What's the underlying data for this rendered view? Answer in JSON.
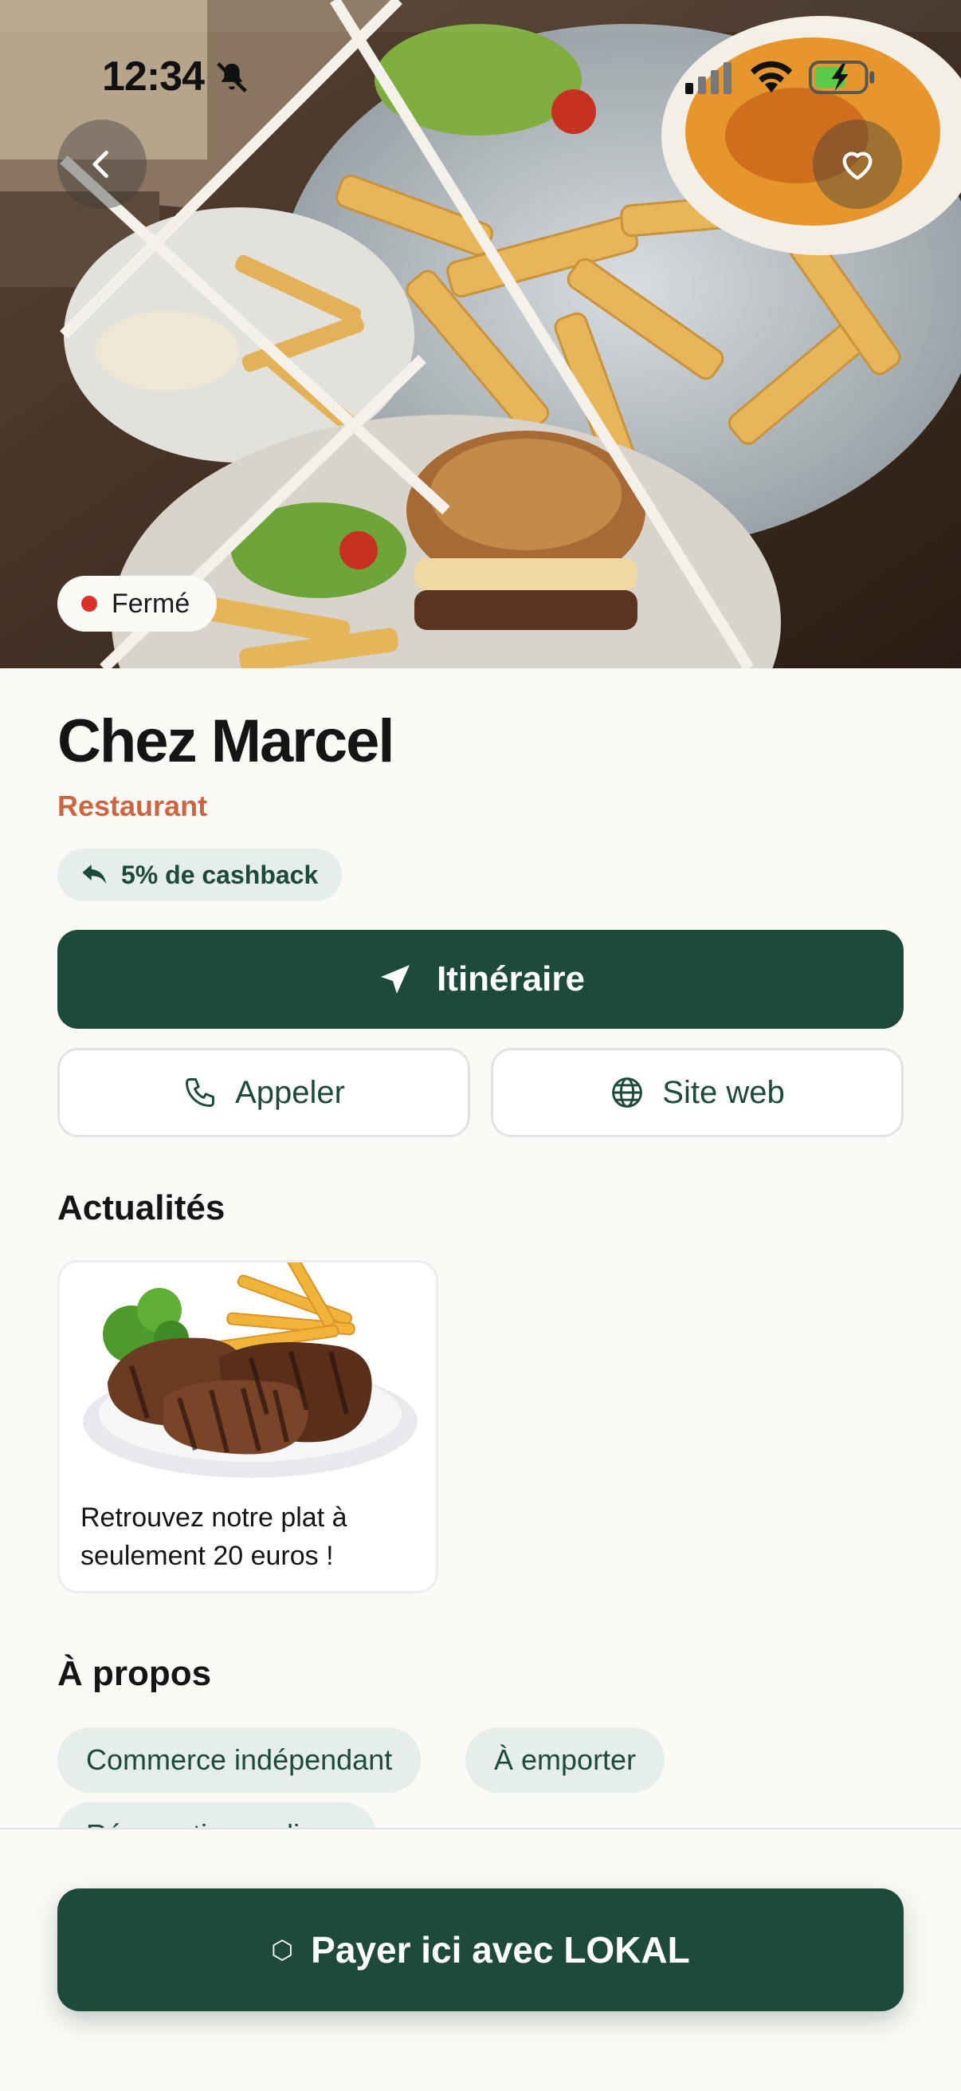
{
  "status_bar": {
    "time": "12:34"
  },
  "hero": {
    "status": "Fermé"
  },
  "place": {
    "name": "Chez Marcel",
    "category": "Restaurant",
    "cashback": "5% de cashback"
  },
  "actions": {
    "directions": "Itinéraire",
    "call": "Appeler",
    "website": "Site web"
  },
  "news": {
    "title": "Actualités",
    "items": [
      {
        "text": "Retrouvez notre plat à seulement 20 euros !"
      }
    ]
  },
  "about": {
    "title": "À propos",
    "tags": [
      "Commerce indépendant",
      "À emporter",
      "Réservation en ligne"
    ]
  },
  "bottom": {
    "pay_label": "Payer ici avec LOKAL",
    "pay_glyph": "⬡"
  },
  "colors": {
    "primary": "#1e4a39",
    "accent": "#cc6640",
    "closed": "#d9302c",
    "chip_bg": "#e6eee9"
  },
  "icons": [
    "chevron-left-icon",
    "heart-icon",
    "bell-slash-icon",
    "signal-icon",
    "wifi-icon",
    "battery-charging-icon",
    "reply-arrow-icon",
    "navigation-arrow-icon",
    "phone-icon",
    "globe-icon"
  ]
}
